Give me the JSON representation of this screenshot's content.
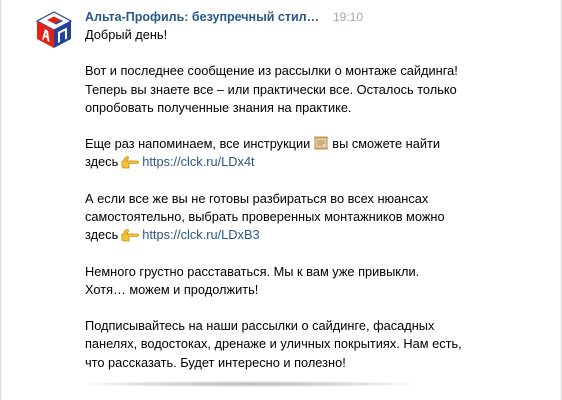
{
  "message": {
    "sender": "Альта-Профиль: безупречный стиль В...",
    "time": "19:10",
    "greeting": "Добрый день!",
    "p1": {
      "line1": "Вот и последнее сообщение из рассылки о монтаже сайдинга!",
      "line2": "Теперь вы знаете все – или практически все. Осталось только",
      "line3": "опробовать полученные знания на практике."
    },
    "p2": {
      "line1_before": "Еще раз напоминаем, все инструкции",
      "line1_after": "вы сможете найти",
      "line2_before": "здесь",
      "link": "https://clck.ru/LDx4t",
      "scroll_emoji": "scroll-icon",
      "pointer_emoji": "pointing-hand-icon"
    },
    "p3": {
      "line1": "А если все же вы не готовы разбираться во всех нюансах",
      "line2": "самостоятельно, выбрать проверенных монтажников можно",
      "line3_before": "здесь",
      "link": "https://clck.ru/LDxB3"
    },
    "p4": {
      "line1": "Немного грустно расставаться. Мы к вам уже привыкли.",
      "line2": "Хотя… можем и продолжить!"
    },
    "p5": {
      "line1": "Подписывайтесь на наши рассылки о сайдинге, фасадных",
      "line2": "панелях, водостоках, дренаже и уличных покрытиях. Нам есть,",
      "line3": "что рассказать. Будет интересно и полезно!"
    }
  },
  "colors": {
    "link": "#2a5885",
    "time": "#a0a6ad",
    "logo_red": "#e2231a",
    "logo_blue": "#24449a"
  }
}
